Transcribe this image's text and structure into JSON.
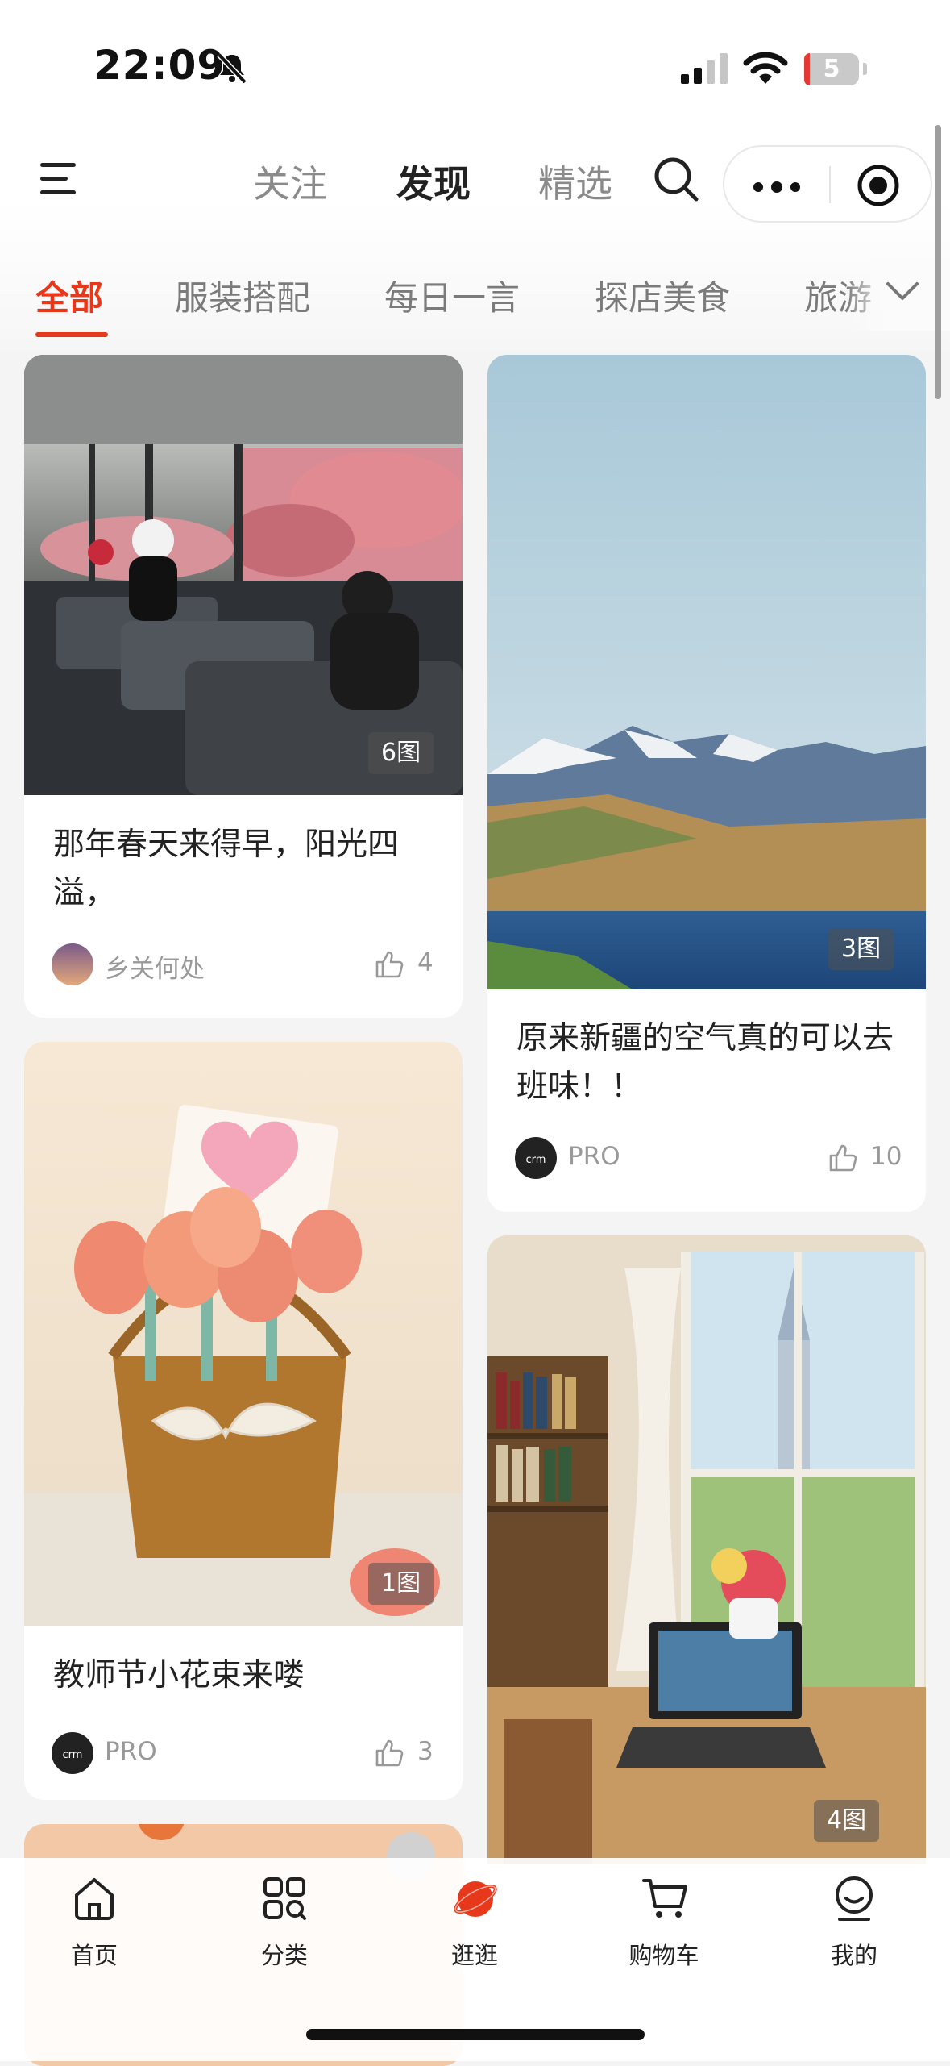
{
  "status_bar": {
    "time": "22:09",
    "battery": "5"
  },
  "header": {
    "nav_tabs": [
      {
        "label": "关注",
        "active": false
      },
      {
        "label": "发现",
        "active": true
      },
      {
        "label": "精选",
        "active": false
      }
    ]
  },
  "categories": [
    {
      "label": "全部",
      "active": true
    },
    {
      "label": "服装搭配",
      "active": false
    },
    {
      "label": "每日一言",
      "active": false
    },
    {
      "label": "探店美食",
      "active": false
    },
    {
      "label": "旅游",
      "active": false
    }
  ],
  "cards": [
    {
      "title": "那年春天来得早，阳光四溢，",
      "image_count": "6图",
      "author": "乡关何处",
      "likes": "4"
    },
    {
      "title": "原来新疆的空气真的可以去班味！！",
      "image_count": "3图",
      "author": "PRO",
      "likes": "10"
    },
    {
      "title": "教师节小花束来喽",
      "image_count": "1图",
      "author": "PRO",
      "likes": "3"
    },
    {
      "title": "",
      "image_count": "4图",
      "author": "",
      "likes": ""
    }
  ],
  "bottom_nav": [
    {
      "label": "首页",
      "icon": "home-icon"
    },
    {
      "label": "分类",
      "icon": "grid-icon"
    },
    {
      "label": "逛逛",
      "icon": "planet-icon",
      "active": true
    },
    {
      "label": "购物车",
      "icon": "cart-icon"
    },
    {
      "label": "我的",
      "icon": "user-icon"
    }
  ],
  "colors": {
    "accent": "#e8381b",
    "muted": "#999999"
  }
}
